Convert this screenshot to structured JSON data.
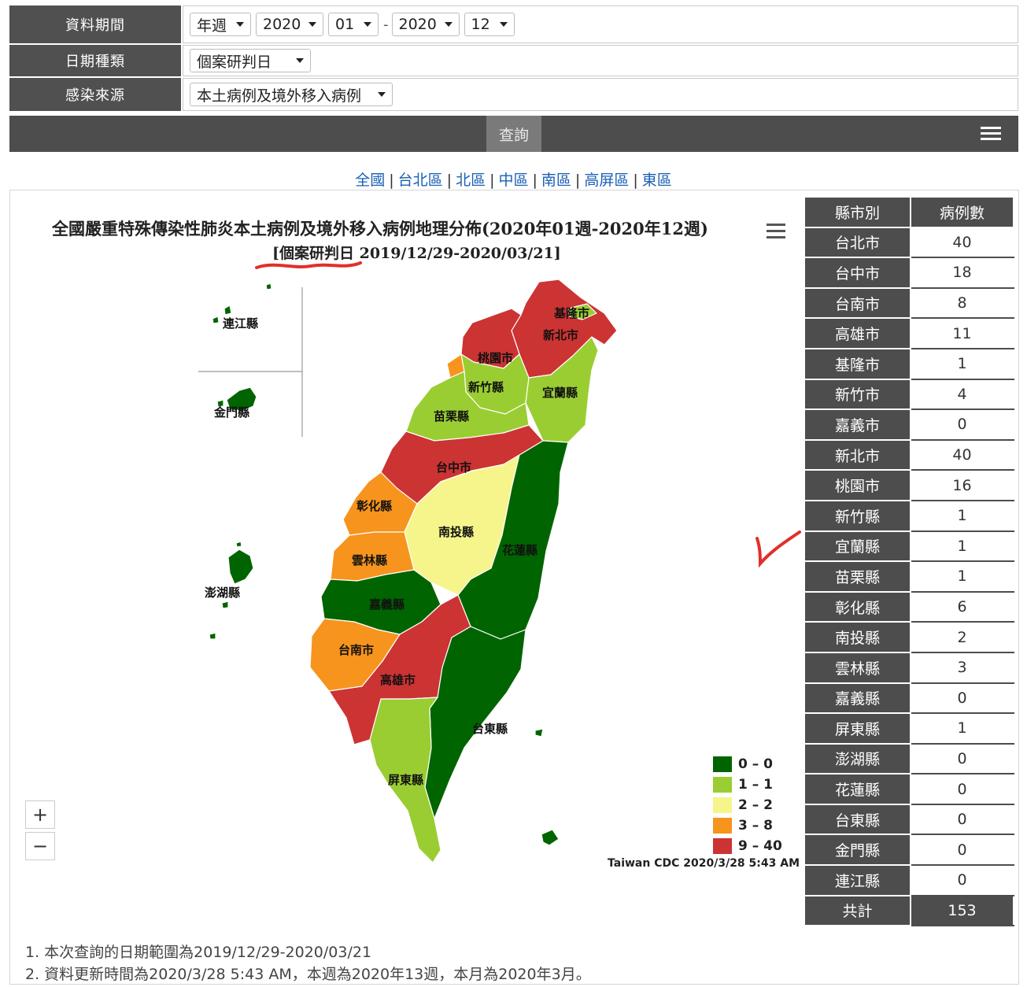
{
  "filters": {
    "period": {
      "label": "資料期間",
      "type": "年週",
      "start_year": "2020",
      "start_week": "01",
      "separator": "-",
      "end_year": "2020",
      "end_week": "12"
    },
    "date_type": {
      "label": "日期種類",
      "value": "個案研判日"
    },
    "source": {
      "label": "感染來源",
      "value": "本土病例及境外移入病例"
    }
  },
  "query_button": "查詢",
  "region_links": [
    "全國",
    "台北區",
    "北區",
    "中區",
    "南區",
    "高屏區",
    "東區"
  ],
  "map": {
    "title": "全國嚴重特殊傳染性肺炎本土病例及境外移入病例地理分佈(2020年01週-2020年12週)",
    "subtitle": "[個案研判日 2019/12/29-2020/03/21]",
    "credit": "Taiwan CDC 2020/3/28 5:43 AM",
    "zoom_in": "+",
    "zoom_out": "−",
    "labels": [
      "基隆市",
      "新北市",
      "桃園市",
      "新竹縣",
      "宜蘭縣",
      "苗栗縣",
      "台中市",
      "彰化縣",
      "南投縣",
      "花蓮縣",
      "雲林縣",
      "嘉義縣",
      "台南市",
      "高雄市",
      "台東縣",
      "屏東縣",
      "連江縣",
      "金門縣",
      "澎湖縣"
    ],
    "colors": {
      "0-0": "#006400",
      "1-1": "#9acd32",
      "2-2": "#f5f58c",
      "3-8": "#f7941d",
      "9-40": "#cc3333"
    },
    "legend": [
      {
        "label": "0 – 0",
        "color": "#006400"
      },
      {
        "label": "1 – 1",
        "color": "#9acd32"
      },
      {
        "label": "2 – 2",
        "color": "#f5f58c"
      },
      {
        "label": "3 – 8",
        "color": "#f7941d"
      },
      {
        "label": "9 – 40",
        "color": "#cc3333"
      }
    ]
  },
  "table": {
    "headers": [
      "縣市別",
      "病例數"
    ],
    "rows": [
      [
        "台北市",
        "40"
      ],
      [
        "台中市",
        "18"
      ],
      [
        "台南市",
        "8"
      ],
      [
        "高雄市",
        "11"
      ],
      [
        "基隆市",
        "1"
      ],
      [
        "新竹市",
        "4"
      ],
      [
        "嘉義市",
        "0"
      ],
      [
        "新北市",
        "40"
      ],
      [
        "桃園市",
        "16"
      ],
      [
        "新竹縣",
        "1"
      ],
      [
        "宜蘭縣",
        "1"
      ],
      [
        "苗栗縣",
        "1"
      ],
      [
        "彰化縣",
        "6"
      ],
      [
        "南投縣",
        "2"
      ],
      [
        "雲林縣",
        "3"
      ],
      [
        "嘉義縣",
        "0"
      ],
      [
        "屏東縣",
        "1"
      ],
      [
        "澎湖縣",
        "0"
      ],
      [
        "花蓮縣",
        "0"
      ],
      [
        "台東縣",
        "0"
      ],
      [
        "金門縣",
        "0"
      ],
      [
        "連江縣",
        "0"
      ]
    ],
    "total": [
      "共計",
      "153"
    ]
  },
  "notes": [
    "1. 本次查詢的日期範圍為2019/12/29-2020/03/21",
    "2. 資料更新時間為2020/3/28 5:43 AM，本週為2020年13週，本月為2020年3月。"
  ]
}
